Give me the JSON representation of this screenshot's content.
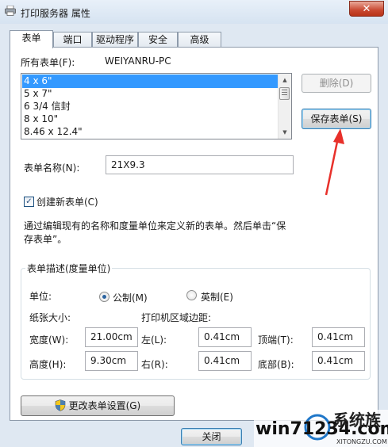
{
  "window": {
    "title": "打印服务器 属性",
    "close_glyph": "✕"
  },
  "tabs": [
    {
      "label": "表单",
      "active": true
    },
    {
      "label": "端口",
      "active": false
    },
    {
      "label": "驱动程序",
      "active": false
    },
    {
      "label": "安全",
      "active": false
    },
    {
      "label": "高级",
      "active": false
    }
  ],
  "forms": {
    "all_forms_label": "所有表单(F):",
    "server_name": "WEIYANRU-PC",
    "list": [
      "4 x 6\"",
      "5 x 7\"",
      "6 3/4 信封",
      "8 x 10\"",
      "8.46 x 12.4\""
    ],
    "selected_index": 0,
    "delete_button": "删除(D)",
    "save_button": "保存表单(S)"
  },
  "form_name": {
    "label": "表单名称(N):",
    "value": "21X9.3"
  },
  "create_new": {
    "label": "创建新表单(C)",
    "checked": true,
    "check_glyph": "✓"
  },
  "description": "通过编辑现有的名称和度量单位来定义新的表单。然后单击“保存表单”。",
  "measurements": {
    "group_title": "表单描述(度量单位)",
    "unit_label": "单位:",
    "unit_metric": "公制(M)",
    "unit_english": "英制(E)",
    "selected_unit": "metric",
    "paper_size_label": "纸张大小:",
    "printer_margins_label": "打印机区域边距:",
    "width_label": "宽度(W):",
    "width_value": "21.00cm",
    "height_label": "高度(H):",
    "height_value": "9.30cm",
    "left_label": "左(L):",
    "left_value": "0.41cm",
    "right_label": "右(R):",
    "right_value": "0.41cm",
    "top_label": "顶端(T):",
    "top_value": "0.41cm",
    "bottom_label": "底部(B):",
    "bottom_value": "0.41cm"
  },
  "change_settings_button": "更改表单设置(G)",
  "footer": {
    "close_button": "关闭"
  },
  "watermark": {
    "text": "win71234.com",
    "brand": "系统族",
    "sub": "XITONGZU.COM"
  },
  "colors": {
    "selection": "#3399ff",
    "annotation_arrow": "#e8302a",
    "close_button": "#c94931"
  }
}
